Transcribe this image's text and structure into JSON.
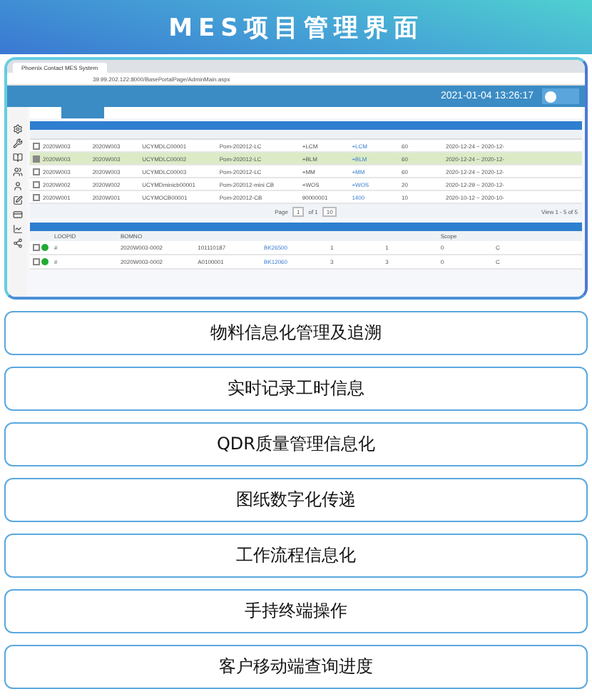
{
  "title": "MES项目管理界面",
  "screenshot": {
    "browser_tab": "Phoenix Contact MES System",
    "address": "39.99.202.122:8000/BasePortalPage/AdminMain.aspx",
    "clock": "2021-01-04 13:26:17",
    "orders": [
      {
        "selected": false,
        "cells": [
          "2020W003",
          "2020W003",
          "UCYMDLC00001",
          "Pom-202012-LC",
          "+LCM",
          "+LCM",
          "60",
          "2020-12-24 ~ 2020-12-"
        ]
      },
      {
        "selected": true,
        "cells": [
          "2020W003",
          "2020W003",
          "UCYMDLC00002",
          "Pom-202012-LC",
          "+BLM",
          "+BLM",
          "60",
          "2020-12-24 ~ 2020-12-"
        ]
      },
      {
        "selected": false,
        "cells": [
          "2020W003",
          "2020W003",
          "UCYMDLC00003",
          "Pom-202012-LC",
          "+MM",
          "+MM",
          "60",
          "2020-12-24 ~ 2020-12-"
        ]
      },
      {
        "selected": false,
        "cells": [
          "2020W002",
          "2020W002",
          "UCYMDminicb00001",
          "Pom-202012-mini CB",
          "+WOS",
          "+WOS",
          "20",
          "2020-12-29 ~ 2020-12-"
        ]
      },
      {
        "selected": false,
        "cells": [
          "2020W001",
          "2020W001",
          "UCYMOCB00001",
          "Pom-202012-CB",
          "90000001",
          "1400",
          "10",
          "2020-10-12 ~ 2020-10-"
        ]
      }
    ],
    "pager": {
      "page_label": "Page",
      "page": "1",
      "of": "of 1",
      "size": "10",
      "view": "View 1 - 5 of 5"
    },
    "materials_columns": [
      "LOOPID",
      "BOMNO",
      "Scope"
    ],
    "materials": [
      {
        "checked": false,
        "color": "#22aa33",
        "cells": [
          "#",
          "2020W003-0002",
          "101110187",
          "BK26500",
          "1",
          "1",
          "0",
          "C"
        ]
      },
      {
        "checked": false,
        "color": "#22aa33",
        "cells": [
          "#",
          "2020W003-0002",
          "A0100001",
          "BK12060",
          "3",
          "3",
          "0",
          "C"
        ]
      }
    ]
  },
  "features": [
    "物料信息化管理及追溯",
    "实时记录工时信息",
    "QDR质量管理信息化",
    "图纸数字化传递",
    "工作流程信息化",
    "手持终端操作",
    "客户移动端查询进度"
  ]
}
